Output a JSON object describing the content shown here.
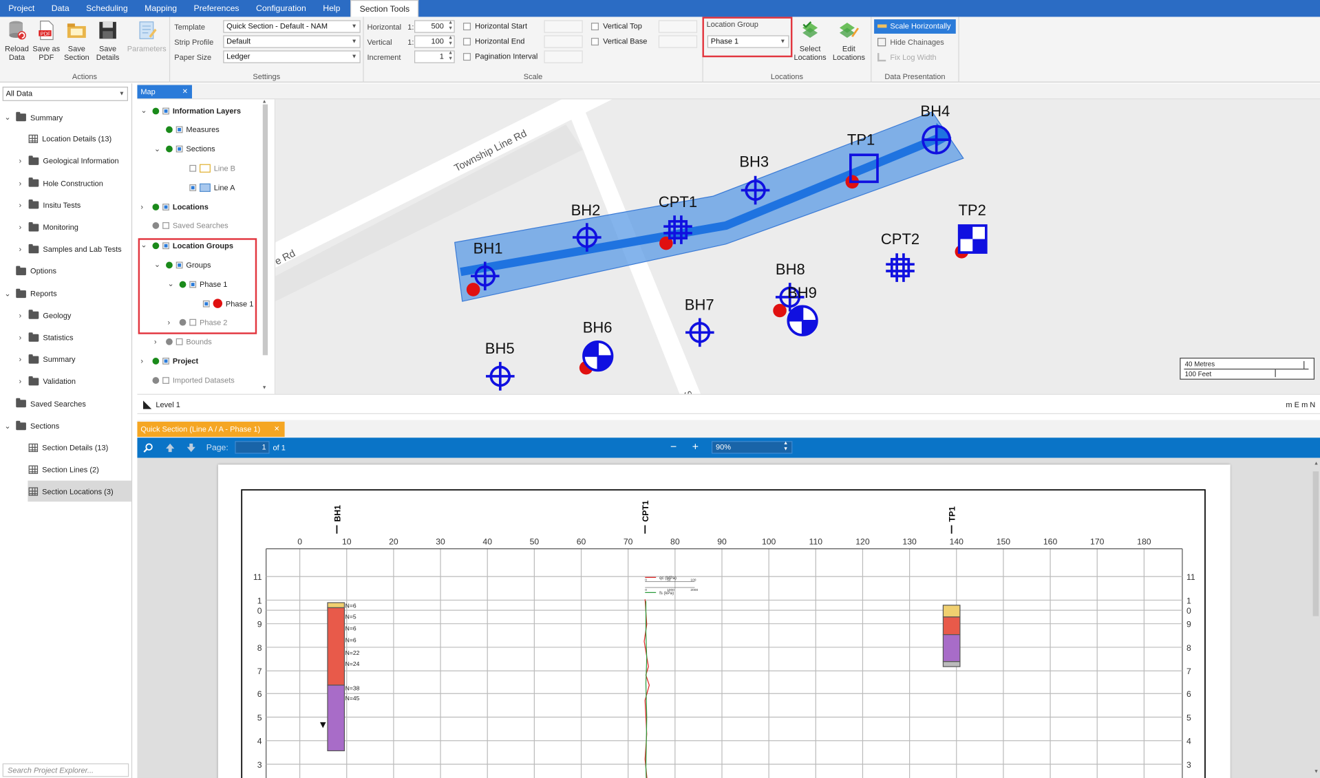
{
  "menu": [
    "Project",
    "Data",
    "Scheduling",
    "Mapping",
    "Preferences",
    "Configuration",
    "Help",
    "Section Tools"
  ],
  "ribbon": {
    "actions": {
      "reload": "Reload Data",
      "savepdf": "Save as PDF",
      "savesection": "Save Section",
      "savedetails": "Save Details",
      "parameters": "Parameters",
      "label": "Actions"
    },
    "settings": {
      "template_label": "Template",
      "template_value": "Quick Section - Default - NAM",
      "strip_label": "Strip Profile",
      "strip_value": "Default",
      "paper_label": "Paper Size",
      "paper_value": "Ledger",
      "label": "Settings"
    },
    "scale": {
      "horizontal_label": "Horizontal",
      "horizontal_value": "500",
      "vertical_label": "Vertical",
      "vertical_value": "100",
      "increment_label": "Increment",
      "increment_value": "1",
      "ratio": "1:",
      "hstart": "Horizontal Start",
      "hend": "Horizontal End",
      "pagination": "Pagination Interval",
      "vtop": "Vertical Top",
      "vbase": "Vertical Base",
      "label": "Scale"
    },
    "locations": {
      "group_label": "Location Group",
      "group_value": "Phase 1",
      "select": "Select Locations",
      "edit": "Edit Locations",
      "label": "Locations"
    },
    "presentation": {
      "scaleh": "Scale Horizontally",
      "hide": "Hide Chainages",
      "fix": "Fix Log Width",
      "label": "Data Presentation"
    }
  },
  "explorer": {
    "filter": "All Data",
    "search_placeholder": "Search Project Explorer...",
    "items": [
      "Summary",
      "Location Details (13)",
      "Geological Information",
      "Hole Construction",
      "Insitu Tests",
      "Monitoring",
      "Samples and Lab Tests",
      "Options",
      "Reports",
      "Geology",
      "Statistics",
      "Summary",
      "Validation",
      "Saved Searches",
      "Sections",
      "Section Details (13)",
      "Section Lines (2)",
      "Section Locations (3)"
    ]
  },
  "map_tab": "Map",
  "layers": [
    "Information Layers",
    "Measures",
    "Sections",
    "Line B",
    "Line A",
    "Locations",
    "Saved Searches",
    "Location Groups",
    "Groups",
    "Phase 1",
    "Phase 1",
    "Phase 2",
    "Bounds",
    "Project",
    "Imported Datasets"
  ],
  "map": {
    "roads": [
      "Township Line Rd",
      "e Rd",
      "Stock"
    ],
    "points": [
      "BH1",
      "BH2",
      "CPT1",
      "BH3",
      "TP1",
      "BH4",
      "TP2",
      "CPT2",
      "BH8",
      "BH9",
      "BH7",
      "BH6",
      "BH5"
    ],
    "scale_m": "40 Metres",
    "scale_ft": "100 Feet",
    "level": "Level 1",
    "units": "m E m N"
  },
  "doc": {
    "tab": "Quick Section (Line A / A - Phase 1)",
    "page_label": "Page:",
    "page_value": "1",
    "of": "of 1",
    "zoom": "90%"
  },
  "section": {
    "locs": [
      "BH1",
      "CPT1",
      "TP1"
    ],
    "xticks": [
      "0",
      "10",
      "20",
      "30",
      "40",
      "50",
      "60",
      "70",
      "80",
      "90",
      "100",
      "110",
      "120",
      "130",
      "140",
      "150",
      "160",
      "170",
      "180"
    ],
    "yticks": [
      "11",
      "1",
      "0",
      "9",
      "8",
      "7",
      "6",
      "5",
      "4",
      "3"
    ],
    "nvalues": [
      "N=6",
      "N=5",
      "N=6",
      "N=6",
      "N=22",
      "N=24",
      "N=38",
      "N=45"
    ],
    "cpt_legend": [
      "qc (MPa)",
      "fs (kPa)"
    ],
    "cpt_ticks": [
      "0",
      "50",
      "100",
      "1000",
      "2000"
    ]
  }
}
